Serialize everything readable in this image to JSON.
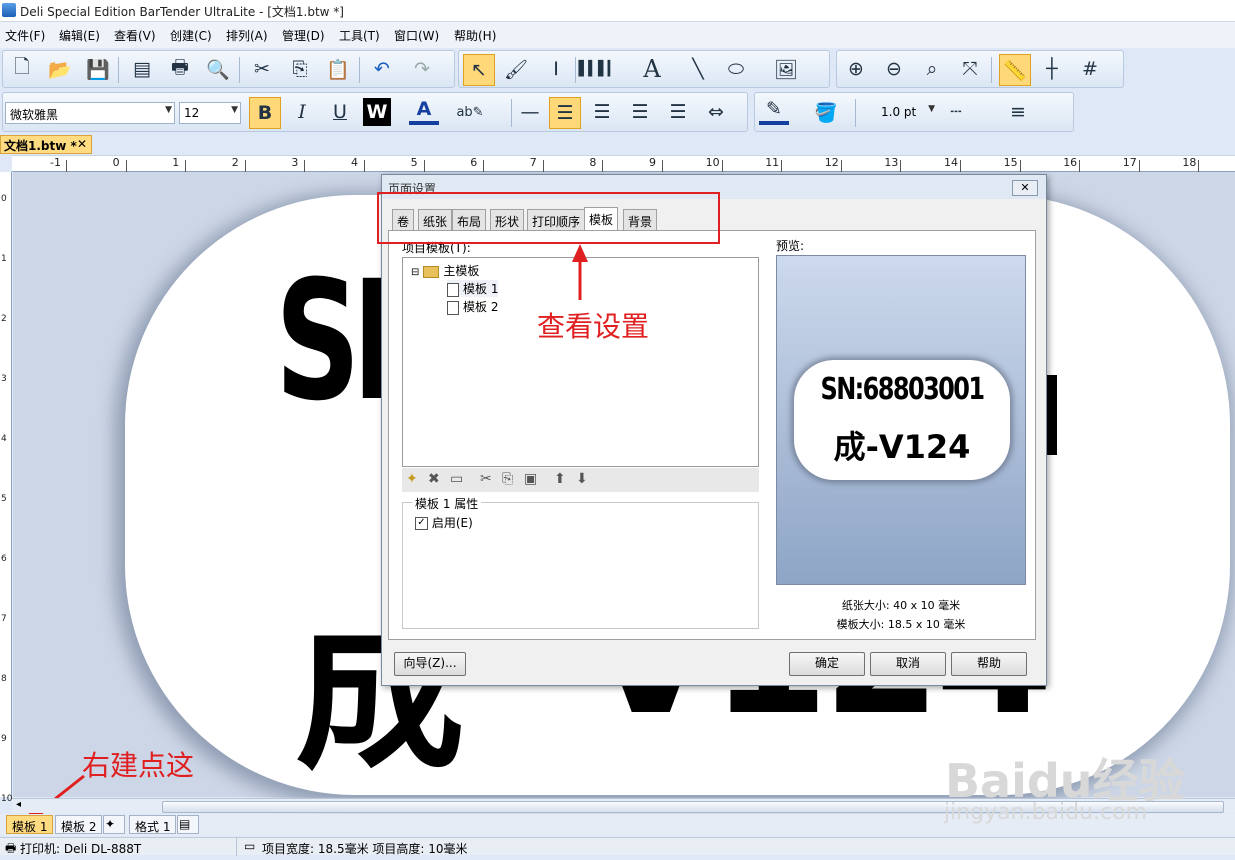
{
  "window": {
    "title": "Deli Special Edition BarTender UltraLite - [文档1.btw *]"
  },
  "menu": [
    "文件(F)",
    "编辑(E)",
    "查看(V)",
    "创建(C)",
    "排列(A)",
    "管理(D)",
    "工具(T)",
    "窗口(W)",
    "帮助(H)"
  ],
  "format_toolbar": {
    "font": "微软雅黑",
    "size": "12",
    "line_width": "1.0 pt"
  },
  "doc_tab": {
    "label": "文档1.btw *",
    "close": "✕"
  },
  "ruler": {
    "top_ticks": [
      "-1",
      "0",
      "1",
      "2",
      "3",
      "4",
      "5",
      "6",
      "7",
      "8",
      "9",
      "10",
      "11",
      "12",
      "13",
      "14",
      "15",
      "16",
      "17",
      "18"
    ],
    "left_ticks": [
      "0",
      "1",
      "2",
      "3",
      "4",
      "5",
      "6",
      "7",
      "8",
      "9",
      "10"
    ]
  },
  "canvas": {
    "line1": "SN",
    "line2": "成",
    "line2b": "V124"
  },
  "dialog": {
    "title": "页面设置",
    "close": "✕",
    "tabs": [
      "卷",
      "纸张",
      "布局",
      "形状",
      "打印顺序",
      "模板",
      "背景"
    ],
    "active_tab": "模板",
    "template_list_label": "项目模板(T):",
    "tree": {
      "root": "主模板",
      "items": [
        "模板 1",
        "模板 2"
      ]
    },
    "props_label": "模板 1 属性",
    "enable_label": "启用(E)",
    "preview_label": "预览:",
    "preview_line1": "SN:68803001",
    "preview_line2": "成-V124",
    "paper_size": "纸张大小: 40 x 10 毫米",
    "template_size": "模板大小: 18.5 x 10 毫米",
    "wizard_btn": "向导(Z)...",
    "ok_btn": "确定",
    "cancel_btn": "取消",
    "help_btn": "帮助"
  },
  "bottom_tabs": [
    "模板 1",
    "模板 2",
    "格式 1"
  ],
  "status": {
    "printer": "打印机: Deli DL-888T",
    "item_size": "项目宽度: 18.5毫米  项目高度: 10毫米"
  },
  "annotations": {
    "view_settings": "查看设置",
    "right_click_here": "右建点这"
  },
  "watermark": {
    "brand": "Baidu经验",
    "url": "jingyan.baidu.com"
  },
  "colors": {
    "annotation": "#e02020",
    "selected": "#ffd879"
  }
}
